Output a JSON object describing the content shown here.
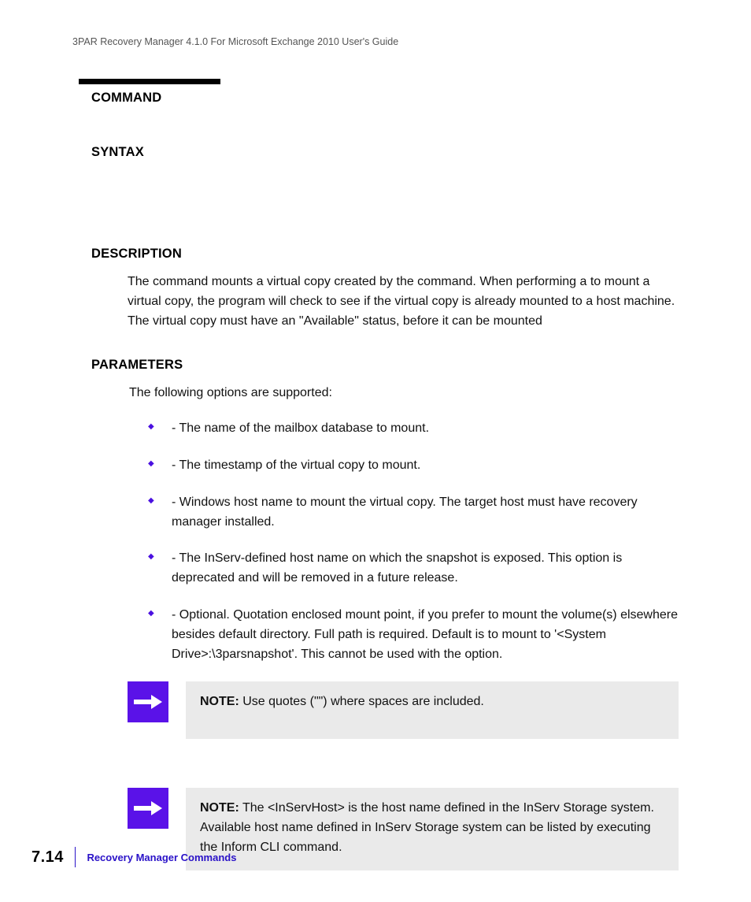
{
  "running_header": "3PAR Recovery Manager 4.1.0 For Microsoft Exchange 2010 User's Guide",
  "sections": {
    "command": "COMMAND",
    "syntax": "SYNTAX",
    "description": "DESCRIPTION",
    "parameters": "PARAMETERS"
  },
  "description_text": "The                               command mounts a virtual copy created by the                               command. When performing a                                      to mount a virtual copy, the program will check to see if the virtual copy is already mounted to a host machine. The virtual copy must have an \"Available\" status, before it can be mounted",
  "params_intro": "The following options are supported:",
  "params": [
    "                                              - The name of the mailbox database to mount.",
    "                              - The timestamp of the virtual copy to mount.",
    "                    - Windows host name to mount the virtual copy. The target host must have recovery manager installed.",
    "                                             - The InServ-defined host name on which the snapshot is exposed. This option is deprecated and will be removed in a future release.",
    "                                 - Optional. Quotation enclosed mount point, if you prefer to mount the volume(s) elsewhere besides default directory. Full path is required. Default is to mount to '<System Drive>:\\3parsnapshot'. This cannot be used with the                 option."
  ],
  "note_label": "NOTE:",
  "note1_text": " Use quotes (\"\") where spaces are included.",
  "note2_text": " The <InServHost> is the host name defined in the InServ Storage system. Available host name defined in InServ Storage system can be listed by executing the Inform CLI                        command.",
  "footer": {
    "page": "7.14",
    "title": "Recovery Manager Commands"
  }
}
